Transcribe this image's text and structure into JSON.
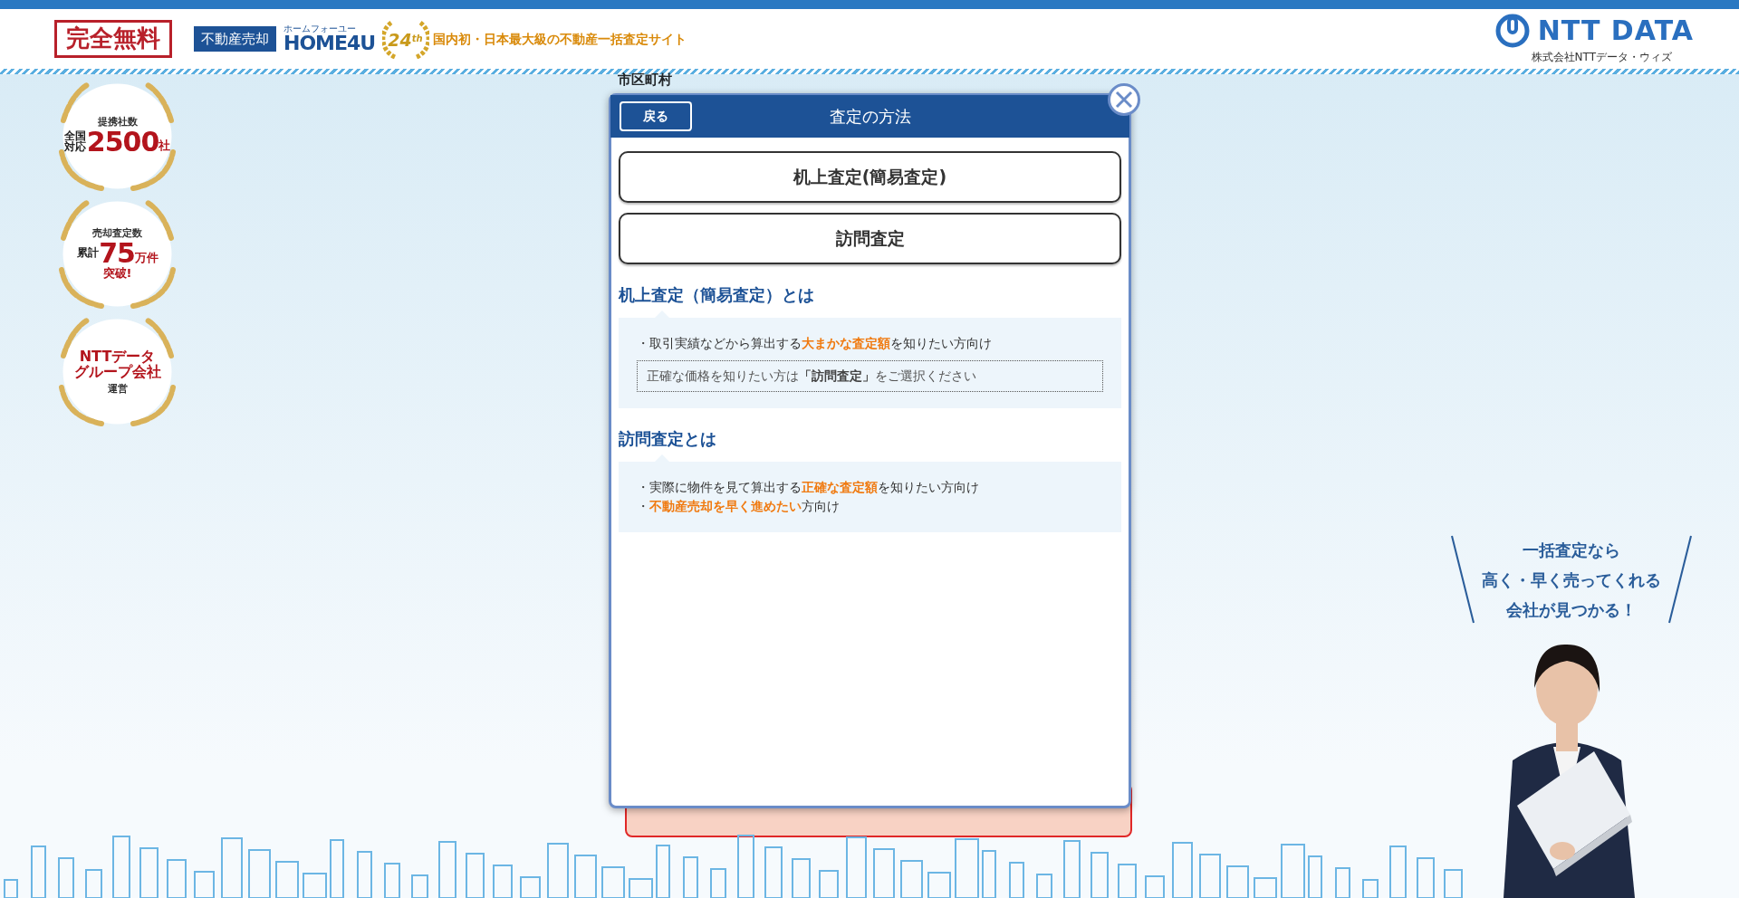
{
  "header": {
    "free_badge": "完全無料",
    "service_tag": "不動産売却",
    "logo_ruby": "ホームフォーユー",
    "logo": "HOME4U",
    "anniversary_number": "24",
    "anniversary_suffix": "th",
    "tagline": "国内初・日本最大級の不動産一括査定サイト",
    "company_logo": "NTT DATA",
    "company_name": "株式会社NTTデータ・ウィズ"
  },
  "badges": [
    {
      "kind": "stat",
      "caption": "提携社数",
      "prefix": "全国対応",
      "number": "2500",
      "unit": "社"
    },
    {
      "kind": "stat",
      "caption": "売却査定数",
      "prefix": "累計",
      "number": "75",
      "unit": "万件",
      "suffix": "突破!"
    },
    {
      "kind": "text",
      "lines": [
        "NTTデータ",
        "グループ会社"
      ],
      "note": "運営"
    }
  ],
  "form": {
    "field_label": "市区町村"
  },
  "modal": {
    "back_button": "戻る",
    "title": "査定の方法",
    "options": [
      "机上査定(簡易査定)",
      "訪問査定"
    ],
    "sections": [
      {
        "heading": "机上査定（簡易査定）とは",
        "points": [
          "・取引実績などから算出する**大まかな査定額**を知りたい方向け"
        ],
        "note": "正確な価格を知りたい方は**「訪問査定」**をご選択ください"
      },
      {
        "heading": "訪問査定とは",
        "points": [
          "・実際に物件を見て算出する**正確な査定額**を知りたい方向け",
          "・**不動産売却を早く進めたい**方向け"
        ]
      }
    ]
  },
  "promo": {
    "lines": [
      "一括査定なら",
      "高く・早く売ってくれる",
      "会社が見つかる！"
    ],
    "kind": "picture"
  }
}
